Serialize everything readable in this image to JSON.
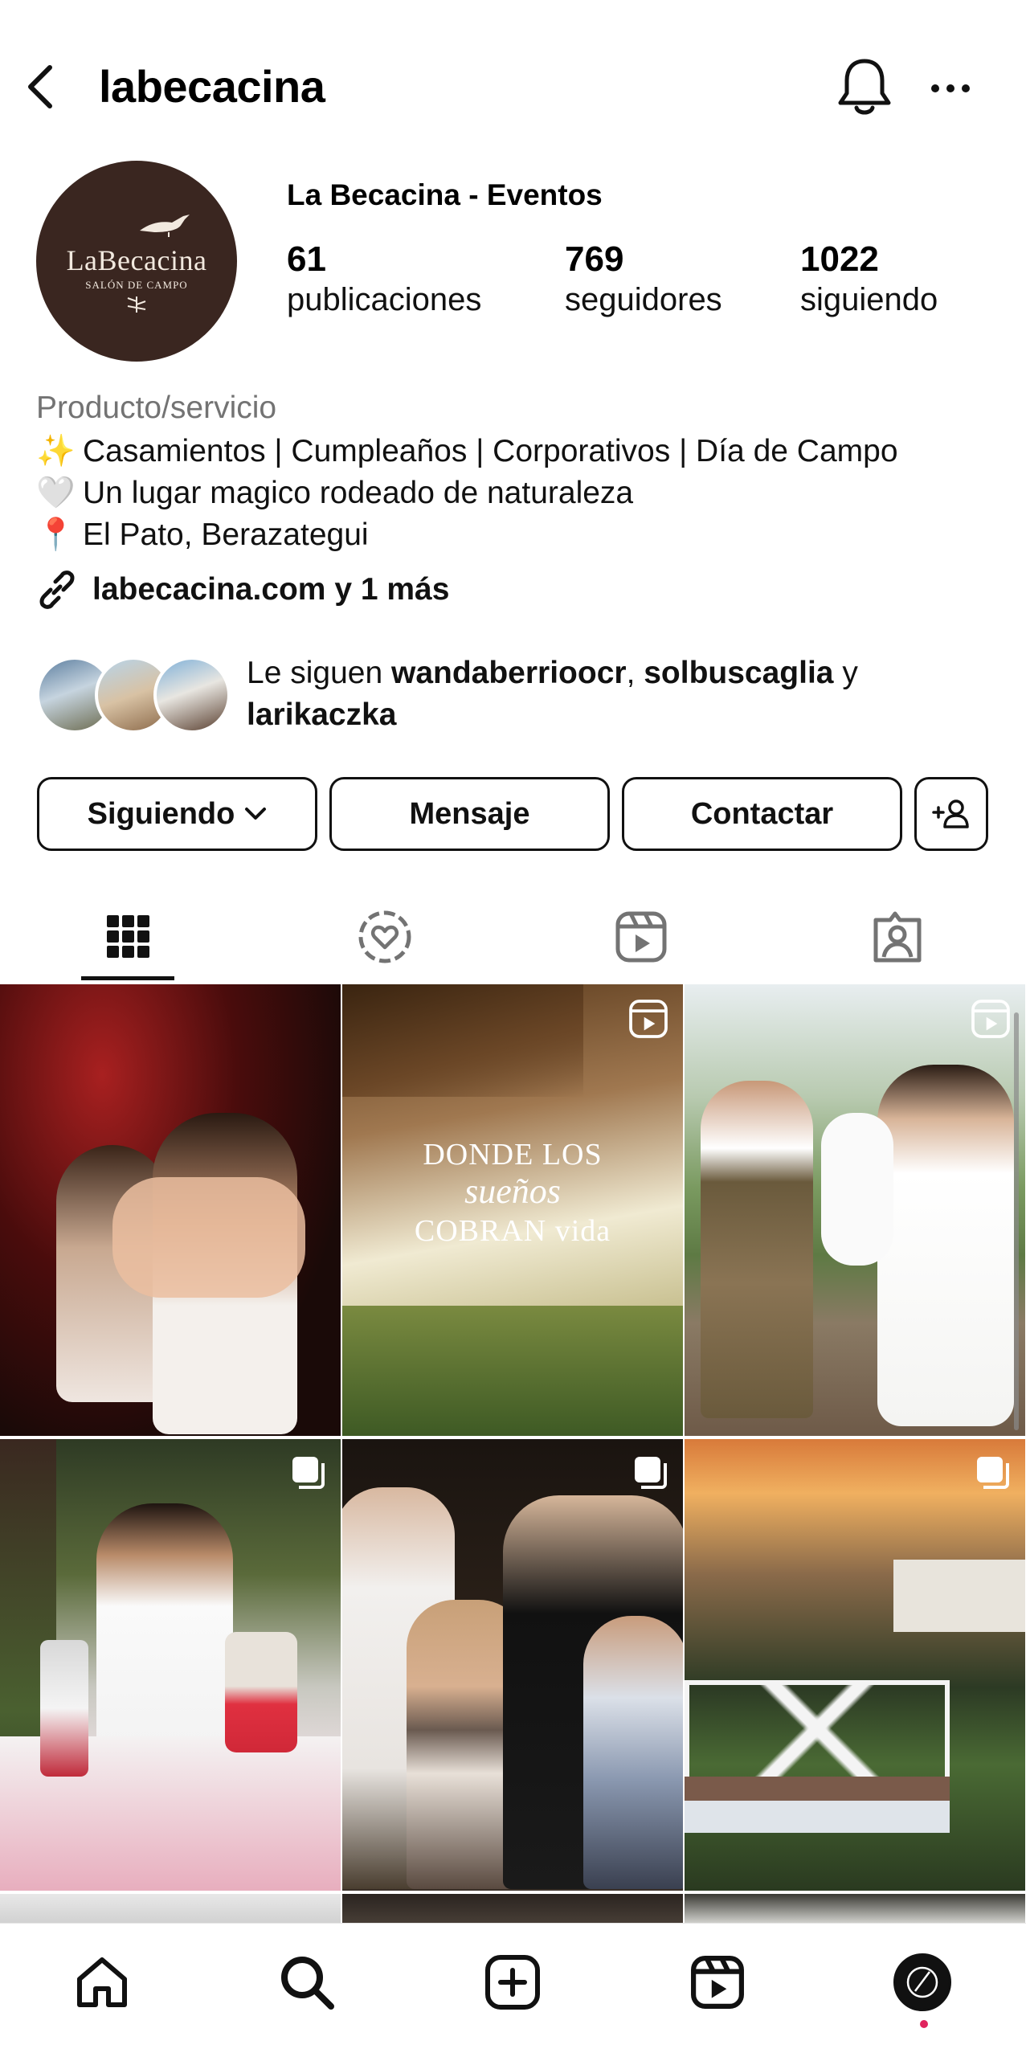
{
  "header": {
    "username": "labecacina"
  },
  "profile": {
    "avatar_logo_main": "LaBecacina",
    "avatar_logo_sub": "SALÓN DE CAMPO",
    "display_name": "La Becacina - Eventos",
    "stats": [
      {
        "value": "61",
        "label": "publicaciones"
      },
      {
        "value": "769",
        "label": "seguidores"
      },
      {
        "value": "1022",
        "label": "siguiendo"
      }
    ],
    "category": "Producto/servicio",
    "bio": [
      {
        "emoji": "✨",
        "text": "Casamientos | Cumpleaños | Corporativos | Día de Campo"
      },
      {
        "emoji": "🤍",
        "text": "Un lugar magico rodeado de naturaleza"
      },
      {
        "emoji": "📍",
        "text": "El Pato, Berazategui"
      }
    ],
    "link": "labecacina.com y 1 más",
    "followed_by": {
      "prefix": "Le siguen ",
      "user1": "wandaberrioocr",
      "sep": ", ",
      "user2": "solbuscaglia",
      "conj": " y",
      "user3": "larikaczka"
    }
  },
  "actions": {
    "following": "Siguiendo",
    "message": "Mensaje",
    "contact": "Contactar"
  },
  "tabs": [
    "grid-icon",
    "hashtag-heart-icon",
    "reels-icon",
    "tagged-icon"
  ],
  "grid": {
    "tile2_caption_line1": "DONDE LOS",
    "tile2_caption_line2": "sueños",
    "tile2_caption_line3": "COBRAN vida"
  },
  "colors": {
    "text": "#111111",
    "secondary": "#737373",
    "avatar_bg": "#3a2620",
    "notification_dot": "#e0245e"
  }
}
